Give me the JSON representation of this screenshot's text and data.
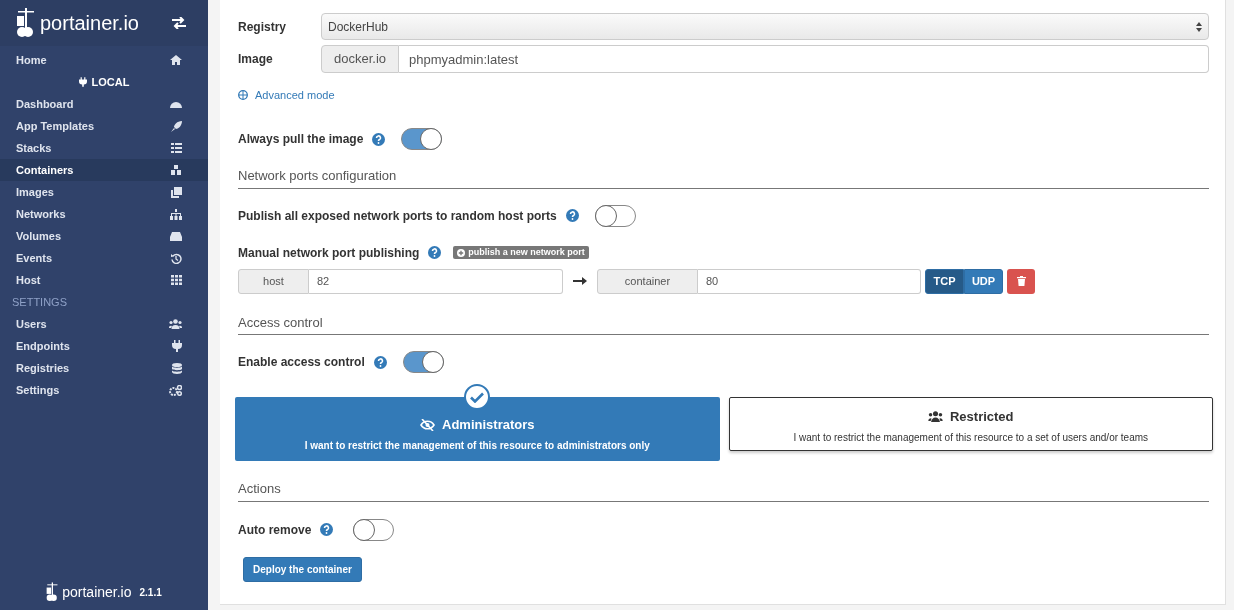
{
  "sidebar": {
    "logo_text": "portainer.io",
    "items": [
      {
        "label": "Home",
        "selected": false
      }
    ],
    "endpoint": "LOCAL",
    "endpoint_items": [
      {
        "label": "Dashboard",
        "selected": false
      },
      {
        "label": "App Templates",
        "selected": false
      },
      {
        "label": "Stacks",
        "selected": false
      },
      {
        "label": "Containers",
        "selected": true
      },
      {
        "label": "Images",
        "selected": false
      },
      {
        "label": "Networks",
        "selected": false
      },
      {
        "label": "Volumes",
        "selected": false
      },
      {
        "label": "Events",
        "selected": false
      },
      {
        "label": "Host",
        "selected": false
      }
    ],
    "settings_heading": "SETTINGS",
    "settings_items": [
      {
        "label": "Users",
        "selected": false
      },
      {
        "label": "Endpoints",
        "selected": false
      },
      {
        "label": "Registries",
        "selected": false
      },
      {
        "label": "Settings",
        "selected": false
      }
    ],
    "footer": {
      "logo_text": "portainer.io",
      "version": "2.1.1"
    }
  },
  "form": {
    "registry": {
      "label": "Registry",
      "value": "DockerHub"
    },
    "image": {
      "label": "Image",
      "prefix": "docker.io",
      "value": "phpmyadmin:latest"
    },
    "advanced_link": "Advanced mode",
    "always_pull": {
      "label": "Always pull the image",
      "on": true
    },
    "network_section": "Network ports configuration",
    "publish_all": {
      "label": "Publish all exposed network ports to random host ports",
      "on": false
    },
    "manual_ports": {
      "label": "Manual network port publishing",
      "add_button": "publish a new network port",
      "ports": [
        {
          "host_label": "host",
          "host": "82",
          "container_label": "container",
          "container": "80",
          "protocols": [
            {
              "label": "TCP",
              "selected": true
            },
            {
              "label": "UDP",
              "selected": false
            }
          ]
        }
      ]
    },
    "access_section": "Access control",
    "enable_access": {
      "label": "Enable access control",
      "on": true
    },
    "access_options": [
      {
        "title": "Administrators",
        "description": "I want to restrict the management of this resource to administrators only",
        "selected": true
      },
      {
        "title": "Restricted",
        "description": "I want to restrict the management of this resource to a set of users and/or teams",
        "selected": false
      }
    ],
    "actions_section": "Actions",
    "auto_remove": {
      "label": "Auto remove",
      "on": false
    },
    "deploy_button": "Deploy the container"
  }
}
